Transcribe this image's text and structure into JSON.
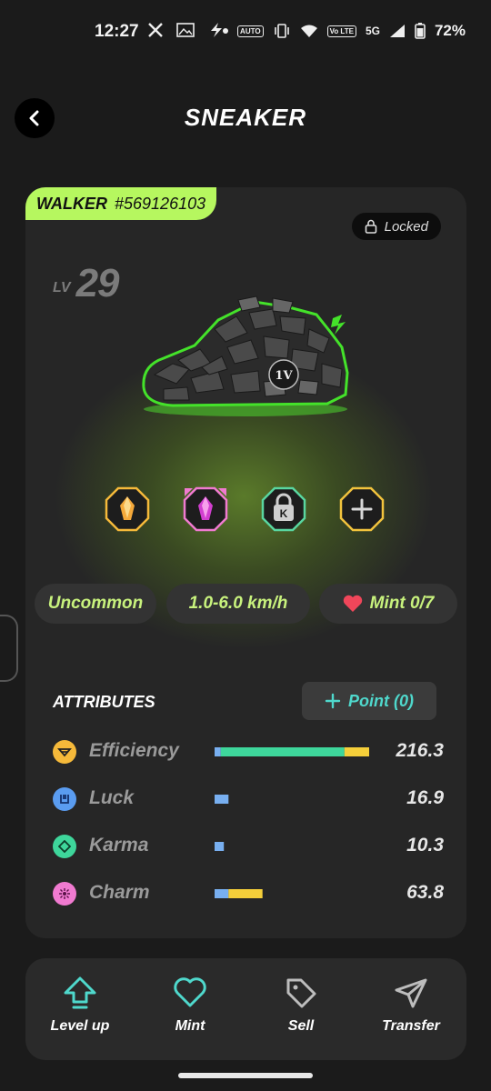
{
  "status_bar": {
    "time": "12:27",
    "auto_label": "AUTO",
    "volte_label": "Vo LTE",
    "network": "5G",
    "battery": "72%"
  },
  "header": {
    "title": "SNEAKER"
  },
  "sneaker": {
    "class": "WALKER",
    "id": "#569126103",
    "lock_status": "Locked",
    "level_label": "LV",
    "level": "29",
    "badge_text": "1V"
  },
  "gem_sockets": [
    {
      "icon": "yellow-gem-icon",
      "color": "#f5b93a"
    },
    {
      "icon": "pink-gem-icon",
      "color": "#f07ad0"
    },
    {
      "icon": "lock-socket-icon",
      "label": "K",
      "color": "#59d6a0"
    },
    {
      "icon": "add-socket-icon",
      "color": "#f2c33d"
    }
  ],
  "pills": {
    "rarity": "Uncommon",
    "speed": "1.0-6.0 km/h",
    "mint": "Mint 0/7"
  },
  "attributes": {
    "title": "ATTRIBUTES",
    "point_button": "Point (0)",
    "items": [
      {
        "name": "Efficiency",
        "value": "216.3",
        "icon": "efficiency-icon",
        "color": "#f5b93a",
        "base_fraction": 0.04,
        "bonus_fraction": 0.8,
        "extra_fraction": 0.16
      },
      {
        "name": "Luck",
        "value": "16.9",
        "icon": "luck-icon",
        "color": "#5a9cf0",
        "base_fraction": 0.09,
        "bonus_fraction": 0,
        "extra_fraction": 0
      },
      {
        "name": "Karma",
        "value": "10.3",
        "icon": "karma-icon",
        "color": "#3ed69b",
        "base_fraction": 0.06,
        "bonus_fraction": 0,
        "extra_fraction": 0
      },
      {
        "name": "Charm",
        "value": "63.8",
        "icon": "charm-icon",
        "color": "#f07ad0",
        "base_fraction": 0.09,
        "bonus_fraction": 0,
        "extra_fraction": 0.22
      }
    ]
  },
  "bottom_nav": [
    {
      "label": "Level up",
      "icon": "level-up-arrow-icon",
      "color": "#4fd8cc"
    },
    {
      "label": "Mint",
      "icon": "heart-icon",
      "color": "#4fd8cc"
    },
    {
      "label": "Sell",
      "icon": "tag-icon",
      "color": "#bdbdbd"
    },
    {
      "label": "Transfer",
      "icon": "send-icon",
      "color": "#bdbdbd"
    }
  ],
  "colors": {
    "accent_green": "#b6f75f",
    "accent_teal": "#4fd8cc",
    "bar_green": "#3ed69b",
    "bar_blue": "#78aff0",
    "bar_yellow": "#f5cf3a"
  }
}
